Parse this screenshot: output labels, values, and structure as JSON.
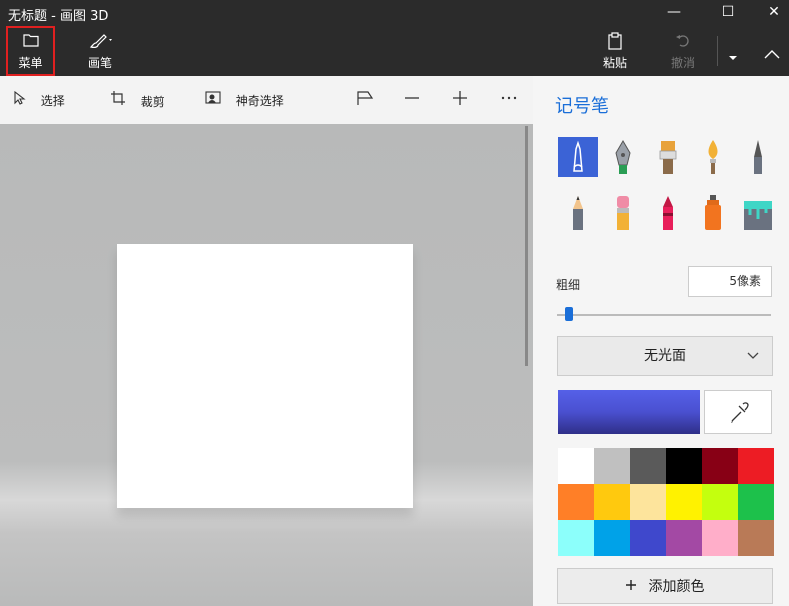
{
  "window": {
    "title": "无标题 - 画图 3D"
  },
  "window_controls": {
    "minimize": "—",
    "maximize": "☐",
    "close": "✕"
  },
  "toolbar": {
    "menu_label": "菜单",
    "brushes_label": "画笔",
    "paste_label": "粘贴",
    "undo_label": "撤消"
  },
  "subtoolbar": {
    "select_label": "选择",
    "crop_label": "裁剪",
    "magic_select_label": "神奇选择"
  },
  "panel": {
    "title": "记号笔",
    "thickness_label": "粗细",
    "thickness_value": "5像素",
    "thickness_fraction": 0.02,
    "finish_dropdown": "无光面",
    "current_color": "#4a50d0",
    "add_color_label": "添加颜色",
    "palette": [
      "#ffffff",
      "#c0c0c0",
      "#5a5a5a",
      "#000000",
      "#880015",
      "#ed1c24",
      "#ff7f27",
      "#ffc90e",
      "#fde49c",
      "#fff200",
      "#c4ff0e",
      "#1dc14b",
      "#8cfffb",
      "#00a2e8",
      "#3f48cc",
      "#a349a4",
      "#ffaec9",
      "#b97a57"
    ],
    "tools": [
      "marker-icon",
      "calligraphy-pen-icon",
      "oil-brush-icon",
      "watercolor-icon",
      "pixel-pen-icon",
      "pencil-icon",
      "eraser-icon",
      "crayon-icon",
      "spray-can-icon",
      "fill-bucket-icon"
    ]
  }
}
